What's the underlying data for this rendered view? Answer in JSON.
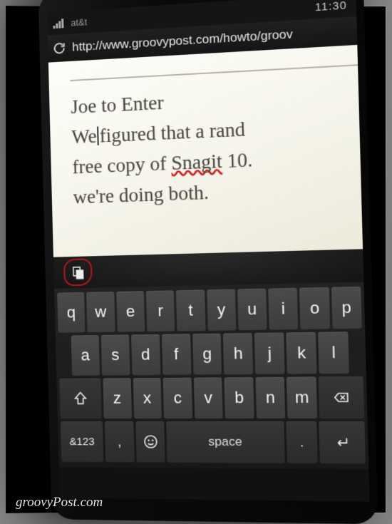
{
  "status": {
    "carrier": "at&t",
    "time": "11:30"
  },
  "address_bar": {
    "url": "http://www.groovypost.com/howto/groov"
  },
  "document": {
    "line1": "Joe to Enter",
    "line2_before": "We",
    "line2_after": "figured that a rand",
    "line3_a": "free copy of ",
    "line3_err": "Snagit",
    "line3_b": " 10.",
    "line4": "we're doing both."
  },
  "keyboard": {
    "row1": [
      "q",
      "w",
      "e",
      "r",
      "t",
      "y",
      "u",
      "i",
      "o",
      "p"
    ],
    "row2": [
      "a",
      "s",
      "d",
      "f",
      "g",
      "h",
      "j",
      "k",
      "l"
    ],
    "row3": [
      "z",
      "x",
      "c",
      "v",
      "b",
      "n",
      "m"
    ],
    "numkey": "&123",
    "comma": ",",
    "space": "space",
    "period": "."
  },
  "watermark": "groovyPost.com"
}
